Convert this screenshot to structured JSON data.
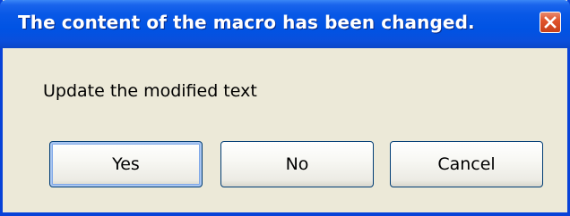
{
  "dialog": {
    "title": "The content of the macro has been changed.",
    "message": "Update the modified text",
    "close_icon": "close-icon",
    "buttons": {
      "yes": "Yes",
      "no": "No",
      "cancel": "Cancel"
    }
  },
  "colors": {
    "titlebar": "#0053e4",
    "window_body": "#ece9d8",
    "close_button": "#e0542c",
    "button_border": "#003c74"
  }
}
